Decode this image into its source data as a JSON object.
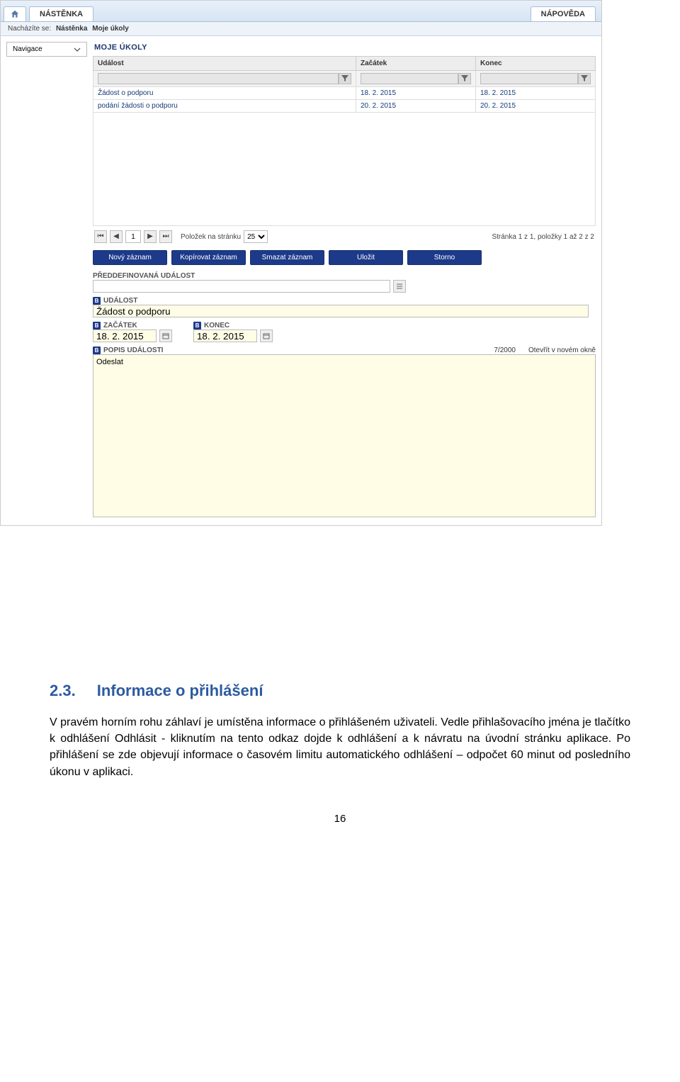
{
  "topbar": {
    "nastenka": "NÁSTĚNKA",
    "napoveda": "NÁPOVĚDA"
  },
  "breadcrumb": {
    "prefix": "Nacházíte se:",
    "item1": "Nástěnka",
    "item2": "Moje úkoly"
  },
  "sidebar": {
    "navigace": "Navigace"
  },
  "section_title": "MOJE ÚKOLY",
  "table": {
    "headers": {
      "udalost": "Událost",
      "zacatek": "Začátek",
      "konec": "Konec"
    },
    "rows": [
      {
        "udalost": "Žádost o podporu",
        "zacatek": "18. 2. 2015",
        "konec": "18. 2. 2015"
      },
      {
        "udalost": "podání žádosti o podporu",
        "zacatek": "20. 2. 2015",
        "konec": "20. 2. 2015"
      }
    ]
  },
  "pager": {
    "items_label": "Položek na stránku",
    "items_value": "25",
    "page_value": "1",
    "right": "Stránka 1 z 1, položky 1 až 2 z 2"
  },
  "actions": {
    "novy": "Nový záznam",
    "kopirovat": "Kopírovat záznam",
    "smazat": "Smazat záznam",
    "ulozit": "Uložit",
    "storno": "Storno"
  },
  "form": {
    "preddefinovana": "PŘEDDEFINOVANÁ UDÁLOST",
    "udalost_label": "UDÁLOST",
    "udalost_value": "Žádost o podporu",
    "zacatek_label": "ZAČÁTEK",
    "zacatek_value": "18. 2. 2015",
    "konec_label": "KONEC",
    "konec_value": "18. 2. 2015",
    "popis_label": "POPIS UDÁLOSTI",
    "popis_counter": "7/2000",
    "popis_open": "Otevřít v novém okně",
    "popis_value": "Odeslat"
  },
  "doc": {
    "heading_num": "2.3.",
    "heading_text": "Informace o přihlášení",
    "paragraph": "V pravém horním rohu záhlaví je umístěna informace o přihlášeném uživateli. Vedle přihlašovacího jména je tlačítko k odhlášení Odhlásit - kliknutím na tento odkaz dojde k odhlášení a k návratu na úvodní stránku aplikace. Po přihlášení se zde objevují informace o časovém limitu automatického odhlášení – odpočet 60 minut od posledního úkonu v aplikaci.",
    "page_number": "16"
  }
}
